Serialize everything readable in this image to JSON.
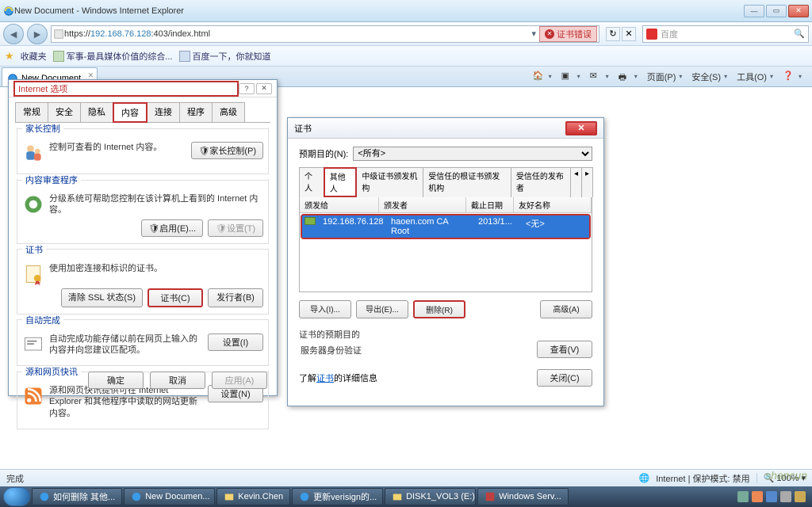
{
  "window": {
    "title": "New Document - Windows Internet Explorer",
    "min": "—",
    "max": "▭",
    "close": "✕"
  },
  "nav": {
    "back": "◄",
    "fwd": "►",
    "url_prefix": "https://",
    "url_host": "192.168.76.128",
    "url_path": ":403/index.html",
    "cert_error": "证书错误",
    "refresh": "↻",
    "stop": "✕",
    "search_placeholder": "百度"
  },
  "favbar": {
    "favorites": "收藏夹",
    "link1": "军事-最具媒体价值的综合...",
    "link2": "百度一下，你就知道"
  },
  "tab": {
    "title": "New Document"
  },
  "cmd": {
    "home": "🏠",
    "rss": "▣",
    "mail": "✉",
    "print": "🖶",
    "page": "页面(P)",
    "safety": "安全(S)",
    "tools": "工具(O)",
    "help": "❓"
  },
  "opt": {
    "title": "Internet 选项",
    "tabs": {
      "general": "常规",
      "security": "安全",
      "privacy": "隐私",
      "content": "内容",
      "connections": "连接",
      "programs": "程序",
      "advanced": "高级"
    },
    "parental": {
      "label": "家长控制",
      "text": "控制可查看的 Internet 内容。",
      "btn": "🛡家长控制(P)"
    },
    "advisor": {
      "label": "内容审查程序",
      "text": "分级系统可帮助您控制在该计算机上看到的 Internet 内容。",
      "enable": "🛡启用(E)...",
      "settings": "🛡设置(T)"
    },
    "certs": {
      "label": "证书",
      "text": "使用加密连接和标识的证书。",
      "clear": "清除 SSL 状态(S)",
      "certbtn": "证书(C)",
      "publishers": "发行者(B)"
    },
    "autocomplete": {
      "label": "自动完成",
      "text": "自动完成功能存储以前在网页上输入的内容并向您建议匹配项。",
      "btn": "设置(I)"
    },
    "feeds": {
      "label": "源和网页快讯",
      "text": "源和网页快讯提供可在 Internet Explorer 和其他程序中读取的网站更新内容。",
      "btn": "设置(N)"
    },
    "ok": "确定",
    "cancel": "取消",
    "apply": "应用(A)"
  },
  "cert": {
    "title": "证书",
    "purpose_label": "预期目的(N):",
    "purpose_value": "<所有>",
    "tabs": {
      "personal": "个人",
      "others": "其他人",
      "intermediate": "中级证书颁发机构",
      "trusted_root": "受信任的根证书颁发机构",
      "trusted_pub": "受信任的发布者"
    },
    "cols": {
      "issued_to": "颁发给",
      "issuer": "颁发者",
      "expires": "截止日期",
      "friendly": "友好名称"
    },
    "row": {
      "issued_to": "192.168.76.128",
      "issuer": "haoen.com CA Root",
      "expires": "2013/1...",
      "friendly": "<无>"
    },
    "import": "导入(I)...",
    "export": "导出(E)...",
    "remove": "删除(R)",
    "advanced": "高级(A)",
    "purposes_header": "证书的预期目的",
    "purposes_text": "服务器身份验证",
    "view": "查看(V)",
    "learn_prefix": "了解",
    "learn_link": "证书",
    "learn_suffix": "的详细信息",
    "close_btn": "关闭(C)"
  },
  "status": {
    "done": "完成",
    "zone": "Internet | 保护模式: 禁用",
    "zoom": "100%"
  },
  "taskbar": {
    "items": [
      "如何删除 其他...",
      "New Documen...",
      "Kevin.Chen",
      "更新verisign的...",
      "DISK1_VOL3 (E:)",
      "Windows Serv..."
    ]
  },
  "watermark": "shancun"
}
